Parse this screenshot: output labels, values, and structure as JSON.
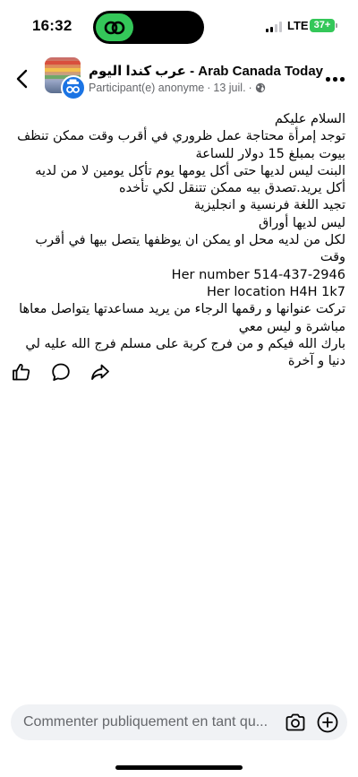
{
  "status_bar": {
    "time": "16:32",
    "network": "LTE",
    "battery": "37+"
  },
  "post": {
    "group_name": "عرب كندا اليوم - Arab Canada Today",
    "author": "Participant(e) anonyme",
    "separator": "·",
    "date": "13 juil.",
    "privacy_icon": "globe-icon",
    "body_lines": [
      "السلام عليكم",
      "توجد إمرأة محتاجة عمل ظروري في أقرب وقت ممكن تنظف بيوت بمبلغ 15 دولار للساعة",
      "البنت ليس لديها حتى أكل يومها يوم تأكل يومين لا من لديه أكل يريد.تصدق بيه ممكن تتنقل لكي تأخده",
      "تجيد اللغة فرنسية و انجليزية",
      "ليس لديها أوراق",
      "لكل من لديه محل او يمكن ان يوظفها يتصل بيها في أقرب وقت",
      "Her number 514-437-2946",
      "Her location H4H 1k7",
      "تركت عنوانها و رقمها الرجاء من يريد مساعدتها يتواصل معاها مباشرة و ليس معي",
      "بارك الله فيكم و من فرج كربة على مسلم فرج الله عليه لي دنيا و آخرة"
    ]
  },
  "actions": {
    "like_icon": "thumbs-up-icon",
    "comment_icon": "comment-bubble-icon",
    "share_icon": "share-arrow-icon"
  },
  "comment_bar": {
    "placeholder": "Commenter publiquement en tant qu...",
    "camera_icon": "camera-icon",
    "add_icon": "plus-circle-icon"
  },
  "colors": {
    "accent": "#1b74e4",
    "green": "#34c759",
    "secondary_text": "#65676b",
    "input_bg": "#f0f2f5"
  }
}
